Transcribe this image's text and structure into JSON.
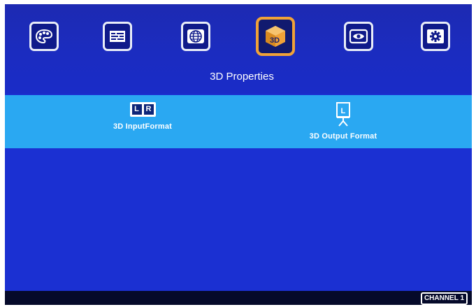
{
  "menu": {
    "title": "3D Properties",
    "icons": [
      {
        "name": "color-palette-icon",
        "selected": false
      },
      {
        "name": "text-layout-icon",
        "selected": false
      },
      {
        "name": "globe-icon",
        "selected": false
      },
      {
        "name": "3d-cube-icon",
        "label": "3D",
        "selected": true
      },
      {
        "name": "eye-display-icon",
        "selected": false
      },
      {
        "name": "gear-icon",
        "selected": false
      }
    ]
  },
  "submenu": {
    "items": [
      {
        "label": "3D InputFormat",
        "icon_name": "lr-icon",
        "icon_letters": [
          "L",
          "R"
        ]
      },
      {
        "label": "3D Output Format",
        "icon_name": "projector-screen-icon",
        "icon_letter": "L"
      }
    ]
  },
  "status": {
    "channel": "CHANNEL 1"
  },
  "colors": {
    "background": "#1b2fd0",
    "submenu_bar": "#2aa8f2",
    "selected_border": "#f0a238",
    "icon_border": "#e9edf8"
  }
}
